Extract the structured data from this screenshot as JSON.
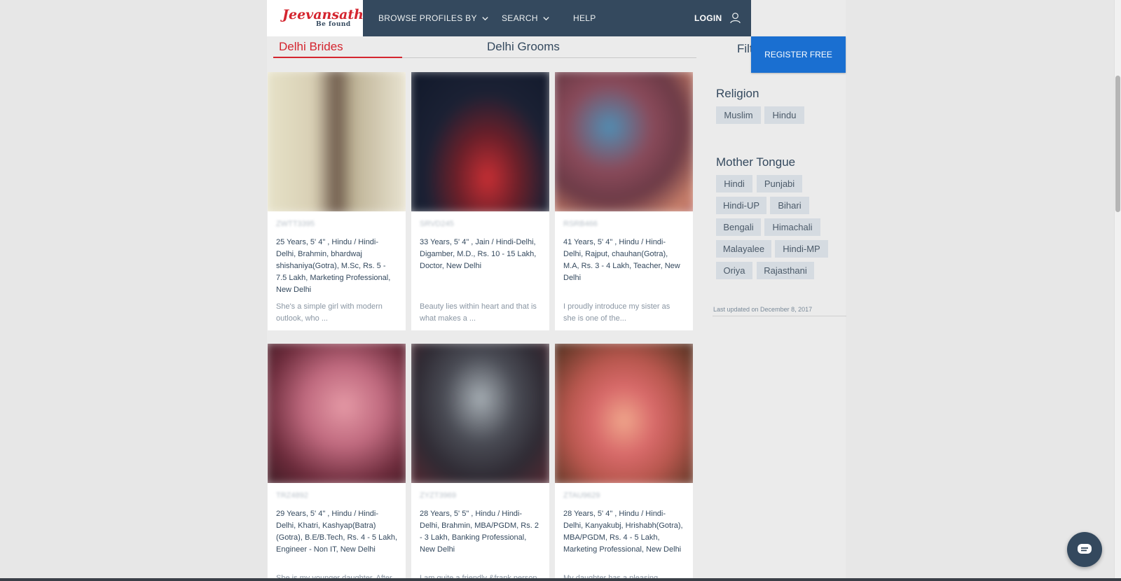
{
  "brand": {
    "logo": "Jeevansathi",
    "tagline": "Be found",
    "accent": "#d4252f",
    "nav_bg": "#34495e",
    "register_bg": "#1a6fd1"
  },
  "nav": {
    "browse": "BROWSE PROFILES BY",
    "search": "SEARCH",
    "help": "HELP",
    "login": "LOGIN",
    "register": "REGISTER FREE"
  },
  "tabs": {
    "brides": "Delhi Brides",
    "grooms": "Delhi Grooms",
    "filter": "Filt"
  },
  "filters": {
    "religion": {
      "heading": "Religion",
      "options": [
        "Muslim",
        "Hindu"
      ]
    },
    "mother_tongue": {
      "heading": "Mother Tongue",
      "options": [
        "Hindi",
        "Punjabi",
        "Hindi-UP",
        "Bihari",
        "Bengali",
        "Himachali",
        "Malayalee",
        "Hindi-MP",
        "Oriya",
        "Rajasthani"
      ]
    },
    "last_updated": "Last updated on December 8, 2017"
  },
  "profiles": [
    {
      "id": "ZWTT3395",
      "details": "25 Years, 5' 4\" , Hindu / Hindi-Delhi, Brahmin, bhardwaj shishaniya(Gotra), M.Sc, Rs. 5 - 7.5 Lakh, Marketing Professional, New Delhi",
      "about": "She's a simple girl with modern outlook, who ..."
    },
    {
      "id": "SRVD245",
      "details": "33 Years, 5' 4\" , Jain / Hindi-Delhi, Digamber, M.D., Rs. 10 - 15 Lakh, Doctor, New Delhi",
      "about": "Beauty lies within heart and that is what makes a ..."
    },
    {
      "id": "RSRB466",
      "details": "41 Years, 5' 4\" , Hindu / Hindi-Delhi, Rajput, chauhan(Gotra), M.A, Rs. 3 - 4 Lakh, Teacher, New Delhi",
      "about": "I proudly introduce my sister as she is one of the..."
    },
    {
      "id": "TRZ4892",
      "details": "29 Years, 5' 4\" , Hindu / Hindi-Delhi, Khatri, Kashyap(Batra)(Gotra), B.E/B.Tech, Rs. 4 - 5 Lakh, Engineer - Non IT, New Delhi",
      "about": "She is my younger daughter. After"
    },
    {
      "id": "ZYZT3969",
      "details": "28 Years, 5' 5\" , Hindu / Hindi-Delhi, Brahmin, MBA/PGDM, Rs. 2 - 3 Lakh, Banking Professional, New Delhi",
      "about": "I am quite a friendly &frank person"
    },
    {
      "id": "ZTAU9629",
      "details": "28 Years, 5' 4\" , Hindu / Hindi-Delhi, Kanyakubj, Hrishabh(Gotra), MBA/PGDM, Rs. 4 - 5 Lakh, Marketing Professional, New Delhi",
      "about": "My daughter has a pleasing"
    }
  ]
}
